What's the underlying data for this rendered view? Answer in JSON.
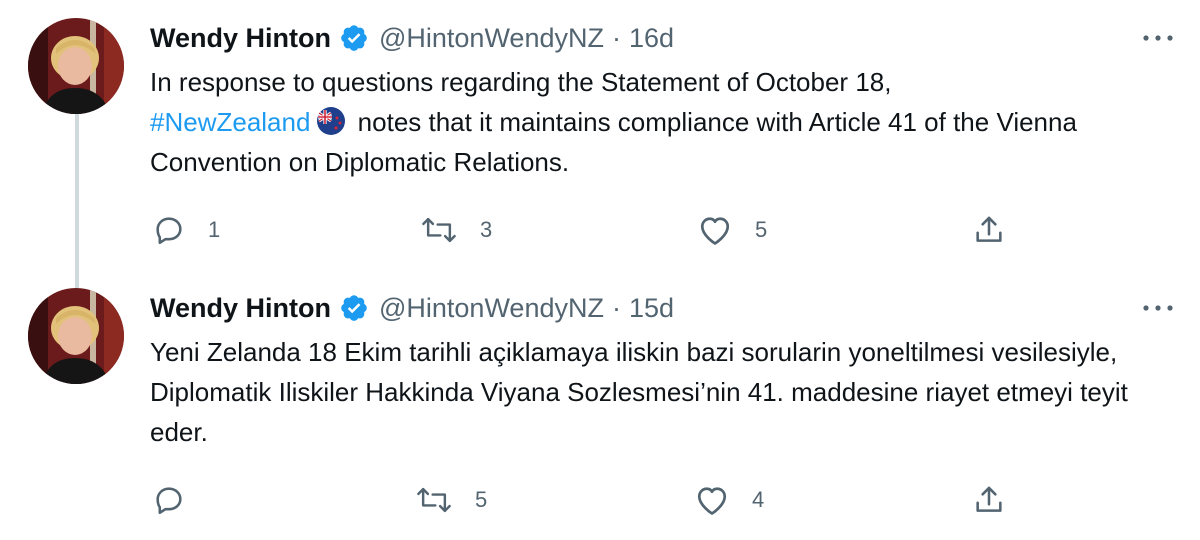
{
  "tweets": [
    {
      "name": "Wendy Hinton",
      "handle": "@HintonWendyNZ",
      "separator": "·",
      "time": "16d",
      "text_before": "In response to questions regarding the Statement of October 18,",
      "hashtag": "#NewZealand",
      "text_after": "notes that it maintains compliance with Article 41 of the Vienna Convention on Diplomatic Relations.",
      "replies": "1",
      "retweets": "3",
      "likes": "5"
    },
    {
      "name": "Wendy Hinton",
      "handle": "@HintonWendyNZ",
      "separator": "·",
      "time": "15d",
      "text": "Yeni Zelanda 18 Ekim tarihli açiklamaya iliskin bazi sorularin yoneltilmesi vesilesiyle, Diplomatik Iliskiler Hakkinda Viyana Sozlesmesi’nin 41. maddesine riayet etmeyi teyit eder.",
      "replies": "",
      "retweets": "5",
      "likes": "4"
    }
  ],
  "colors": {
    "link": "#1d9bf0",
    "secondary_text": "#536471",
    "thread_line": "#cfd9de",
    "verified_badge": "#1d9bf0"
  },
  "icons": [
    "verified-badge-icon",
    "more-icon",
    "reply-icon",
    "retweet-icon",
    "like-icon",
    "share-icon",
    "nz-flag-icon"
  ]
}
